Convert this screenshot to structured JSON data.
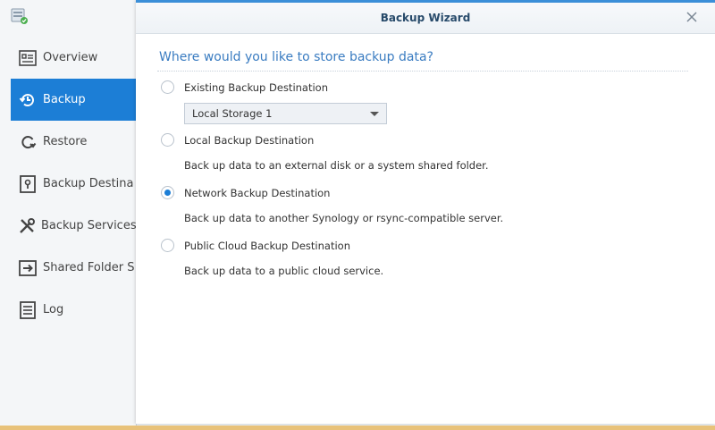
{
  "window": {
    "title": "Backup Wizard"
  },
  "icons": {
    "app": "backup-app-icon",
    "close": "close-icon"
  },
  "sidebar": {
    "items": [
      {
        "label": "Overview",
        "icon": "overview-icon",
        "active": false
      },
      {
        "label": "Backup",
        "icon": "backup-clock-icon",
        "active": true
      },
      {
        "label": "Restore",
        "icon": "restore-icon",
        "active": false
      },
      {
        "label": "Backup Destina",
        "icon": "vault-icon",
        "active": false
      },
      {
        "label": "Backup Services",
        "icon": "tools-icon",
        "active": false
      },
      {
        "label": "Shared Folder S",
        "icon": "shared-folder-sync-icon",
        "active": false
      },
      {
        "label": "Log",
        "icon": "log-list-icon",
        "active": false
      }
    ]
  },
  "wizard": {
    "heading": "Where would you like to store backup data?",
    "options": [
      {
        "label": "Existing Backup Destination",
        "checked": false,
        "description": ""
      },
      {
        "label": "Local Backup Destination",
        "checked": false,
        "description": "Back up data to an external disk or a system shared folder."
      },
      {
        "label": "Network Backup Destination",
        "checked": true,
        "description": "Back up data to another Synology or rsync-compatible server."
      },
      {
        "label": "Public Cloud Backup Destination",
        "checked": false,
        "description": "Back up data to a public cloud service."
      }
    ],
    "existing_select": {
      "value": "Local Storage 1"
    }
  },
  "colors": {
    "accent": "#1c7ed6",
    "heading": "#3a7cc1",
    "bottom_bar": "#e8c27a"
  }
}
